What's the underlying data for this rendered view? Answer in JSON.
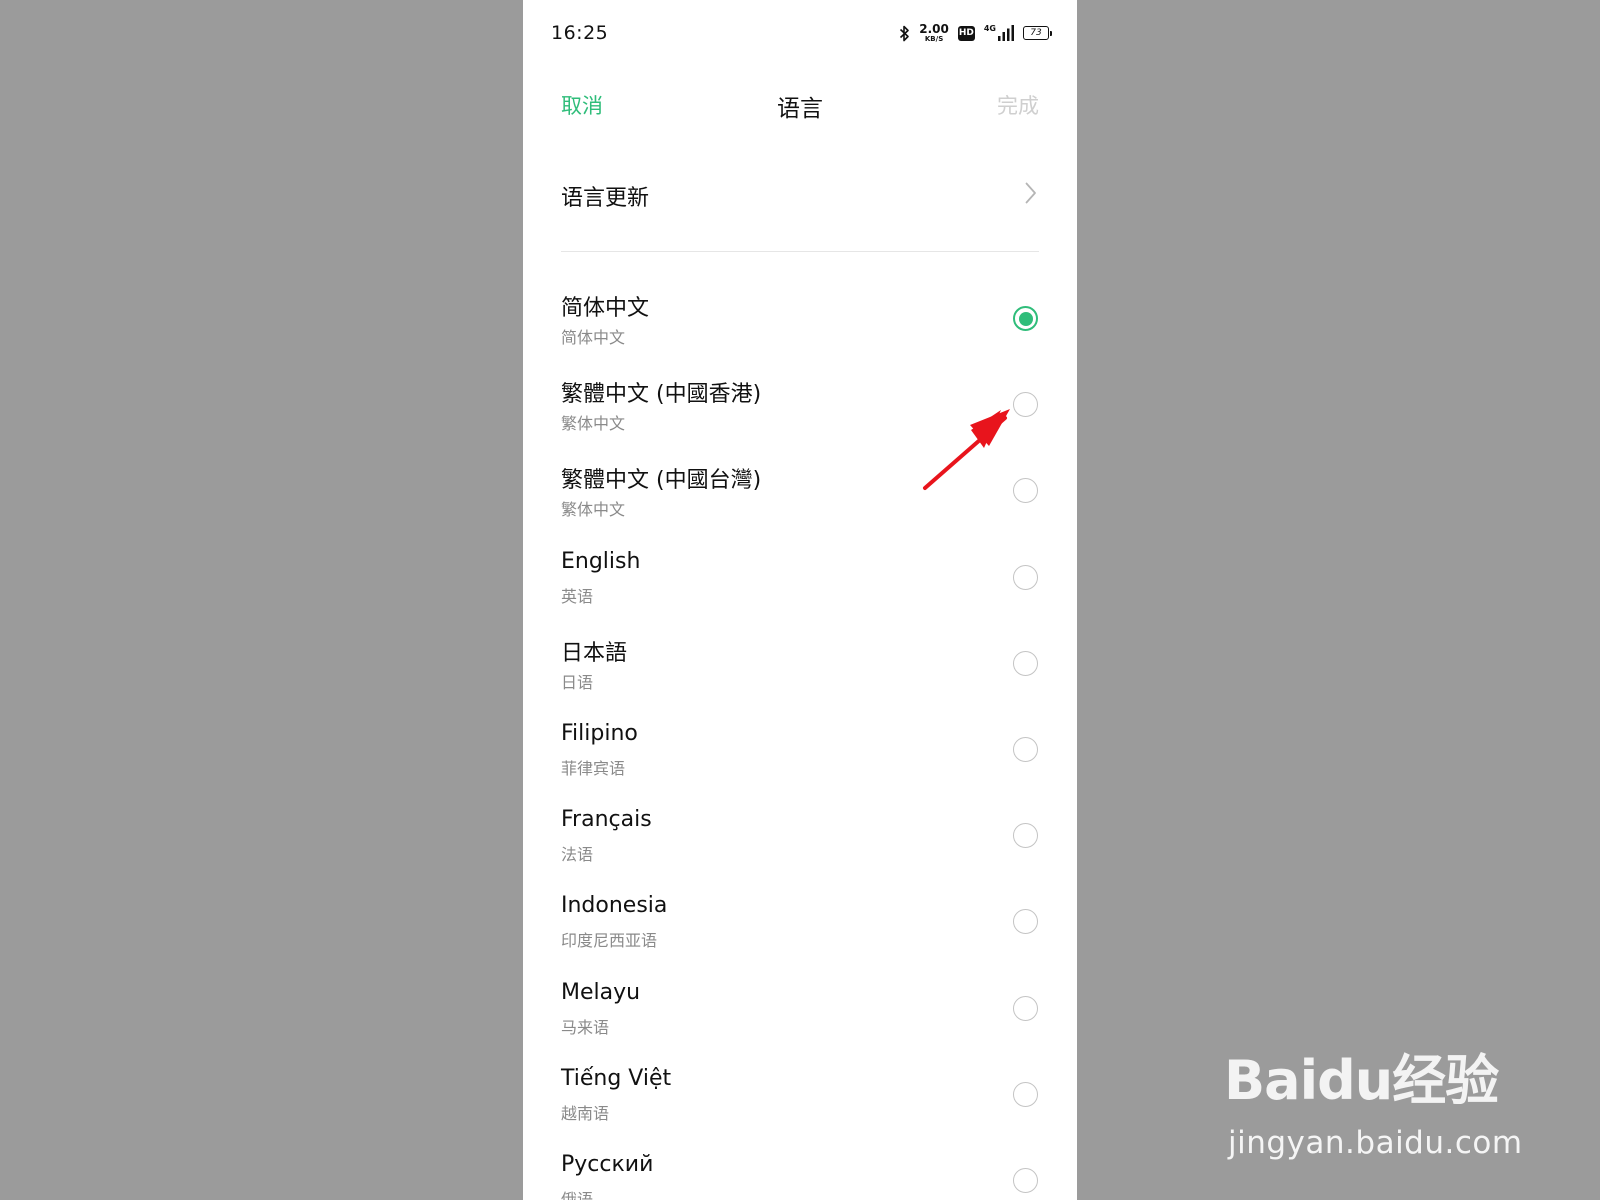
{
  "status_bar": {
    "time": "16:25",
    "net_speed_value": "2.00",
    "net_speed_unit": "KB/S",
    "hd_label": "HD",
    "signal_label": "4G",
    "battery_level": "73"
  },
  "header": {
    "cancel_label": "取消",
    "title": "语言",
    "done_label": "完成"
  },
  "language_update": {
    "label": "语言更新"
  },
  "languages": [
    {
      "name": "简体中文",
      "subtitle": "简体中文",
      "selected": true
    },
    {
      "name": "繁體中文 (中國香港)",
      "subtitle": "繁体中文",
      "selected": false
    },
    {
      "name": "繁體中文 (中國台灣)",
      "subtitle": "繁体中文",
      "selected": false
    },
    {
      "name": "English",
      "subtitle": "英语",
      "selected": false
    },
    {
      "name": "日本語",
      "subtitle": "日语",
      "selected": false
    },
    {
      "name": "Filipino",
      "subtitle": "菲律宾语",
      "selected": false
    },
    {
      "name": "Français",
      "subtitle": "法语",
      "selected": false
    },
    {
      "name": "Indonesia",
      "subtitle": "印度尼西亚语",
      "selected": false
    },
    {
      "name": "Melayu",
      "subtitle": "马来语",
      "selected": false
    },
    {
      "name": "Tiếng Việt",
      "subtitle": "越南语",
      "selected": false
    },
    {
      "name": "Русский",
      "subtitle": "俄语",
      "selected": false
    }
  ],
  "colors": {
    "accent": "#2fbd7a",
    "annotation_arrow": "#e8141c",
    "background": "#9b9b9b"
  },
  "watermark": {
    "brand": "Baidu经验",
    "site": "jingyan.baidu.com"
  }
}
